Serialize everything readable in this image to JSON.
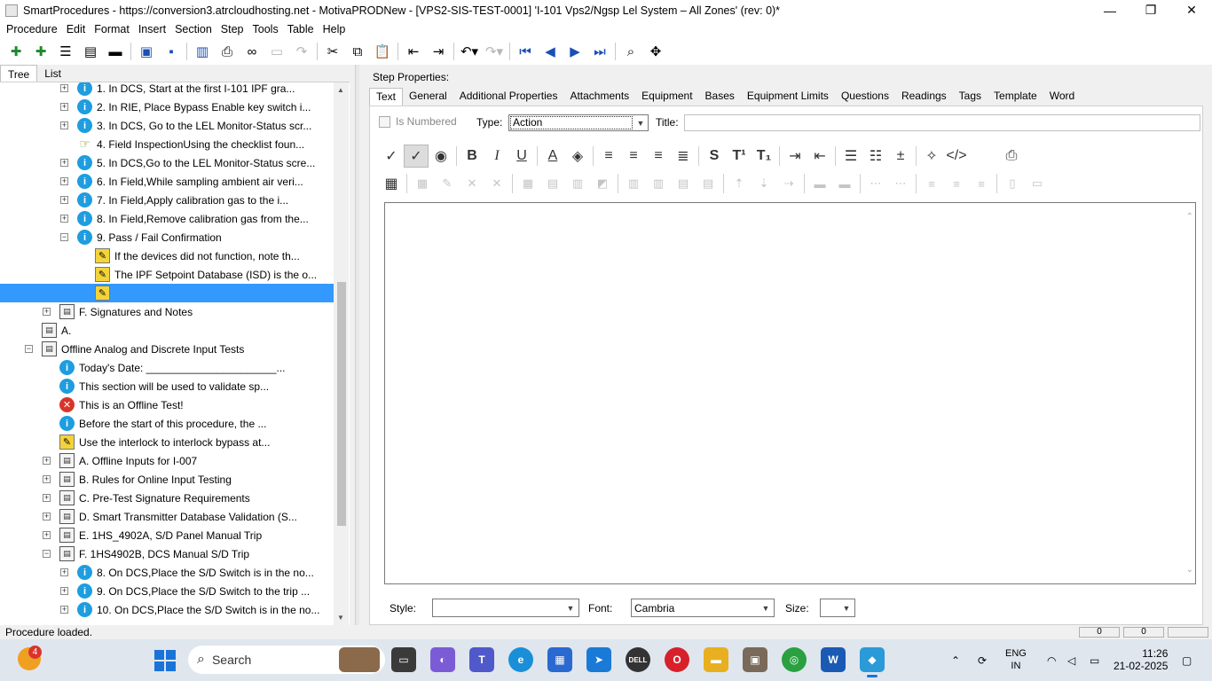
{
  "window": {
    "title": "SmartProcedures - https://conversion3.atrcloudhosting.net - MotivaPRODNew - [VPS2-SIS-TEST-0001] 'I-101 Vps2/Ngsp Lel System – All Zones' (rev: 0)*",
    "min_glyph": "—",
    "max_glyph": "❐",
    "close_glyph": "✕"
  },
  "menu": [
    "Procedure",
    "Edit",
    "Format",
    "Insert",
    "Section",
    "Step",
    "Tools",
    "Table",
    "Help"
  ],
  "left_tabs": [
    "Tree",
    "List"
  ],
  "tree": [
    {
      "indent": 3,
      "exp": "+",
      "icon": "info",
      "text": "1. In DCS, Start at the first I-101 IPF gra..."
    },
    {
      "indent": 3,
      "exp": "+",
      "icon": "info",
      "text": "2. In RIE, Place Bypass Enable key switch i..."
    },
    {
      "indent": 3,
      "exp": "+",
      "icon": "info",
      "text": "3. In DCS, Go to the LEL Monitor-Status scr..."
    },
    {
      "indent": 3,
      "exp": "",
      "icon": "hand",
      "text": "4. Field InspectionUsing the checklist foun..."
    },
    {
      "indent": 3,
      "exp": "+",
      "icon": "info",
      "text": "5. In DCS,Go to the LEL Monitor-Status scre..."
    },
    {
      "indent": 3,
      "exp": "+",
      "icon": "info",
      "text": "6. In Field,While sampling ambient air veri..."
    },
    {
      "indent": 3,
      "exp": "+",
      "icon": "info",
      "text": "7. In Field,Apply calibration gas to the i..."
    },
    {
      "indent": 3,
      "exp": "+",
      "icon": "info",
      "text": "8. In Field,Remove calibration gas from the..."
    },
    {
      "indent": 3,
      "exp": "−",
      "icon": "info",
      "text": "9. Pass / Fail Confirmation"
    },
    {
      "indent": 4,
      "exp": "",
      "icon": "warn",
      "text": "If the devices did not function, note th..."
    },
    {
      "indent": 4,
      "exp": "",
      "icon": "warn",
      "text": "The IPF Setpoint Database (ISD) is the o..."
    },
    {
      "indent": 4,
      "exp": "",
      "icon": "warn",
      "text": "",
      "selected": true
    },
    {
      "indent": 2,
      "exp": "+",
      "icon": "folder",
      "text": "F. Signatures and Notes"
    },
    {
      "indent": 1,
      "exp": "",
      "icon": "folder",
      "text": "A."
    },
    {
      "indent": 1,
      "exp": "−",
      "icon": "folder",
      "text": "Offline Analog and Discrete Input Tests"
    },
    {
      "indent": 2,
      "exp": "",
      "icon": "info",
      "text": "Today's Date: ______________________..."
    },
    {
      "indent": 2,
      "exp": "",
      "icon": "info",
      "text": "This section will be used to validate sp..."
    },
    {
      "indent": 2,
      "exp": "",
      "icon": "err",
      "text": "This is an Offline Test!"
    },
    {
      "indent": 2,
      "exp": "",
      "icon": "info",
      "text": "Before the start of this procedure, the ..."
    },
    {
      "indent": 2,
      "exp": "",
      "icon": "warn",
      "text": "Use the interlock to interlock bypass at..."
    },
    {
      "indent": 2,
      "exp": "+",
      "icon": "folder",
      "text": "A. Offline Inputs for I-007"
    },
    {
      "indent": 2,
      "exp": "+",
      "icon": "folder",
      "text": "B. Rules for Online Input Testing"
    },
    {
      "indent": 2,
      "exp": "+",
      "icon": "folder",
      "text": "C. Pre-Test Signature Requirements"
    },
    {
      "indent": 2,
      "exp": "+",
      "icon": "folder",
      "text": "D. Smart Transmitter Database Validation (S..."
    },
    {
      "indent": 2,
      "exp": "+",
      "icon": "folder",
      "text": "E. 1HS_4902A, S/D Panel Manual Trip"
    },
    {
      "indent": 2,
      "exp": "−",
      "icon": "folder",
      "text": "F. 1HS4902B, DCS Manual S/D Trip"
    },
    {
      "indent": 3,
      "exp": "+",
      "icon": "info",
      "text": "8. On DCS,Place the S/D Switch is in the no..."
    },
    {
      "indent": 3,
      "exp": "+",
      "icon": "info",
      "text": "9. On DCS,Place the S/D Switch to the trip ..."
    },
    {
      "indent": 3,
      "exp": "+",
      "icon": "info",
      "text": "10. On DCS,Place the S/D Switch is in the no..."
    }
  ],
  "step": {
    "header": "Step Properties:",
    "tabs": [
      "Text",
      "General",
      "Additional Properties",
      "Attachments",
      "Equipment",
      "Bases",
      "Equipment Limits",
      "Questions",
      "Readings",
      "Tags",
      "Template",
      "Word"
    ],
    "is_numbered_label": "Is Numbered",
    "type_label": "Type:",
    "type_value": "Action",
    "title_label": "Title:",
    "title_value": "",
    "style_label": "Style:",
    "style_value": "",
    "font_label": "Font:",
    "font_value": "Cambria",
    "size_label": "Size:",
    "size_value": ""
  },
  "status": {
    "text": "Procedure loaded.",
    "panel1": "0",
    "panel2": "0"
  },
  "taskbar": {
    "search_label": "Search",
    "weather_badge": "4",
    "lang_top": "ENG",
    "lang_bottom": "IN",
    "time": "11:26",
    "date": "21-02-2025"
  }
}
